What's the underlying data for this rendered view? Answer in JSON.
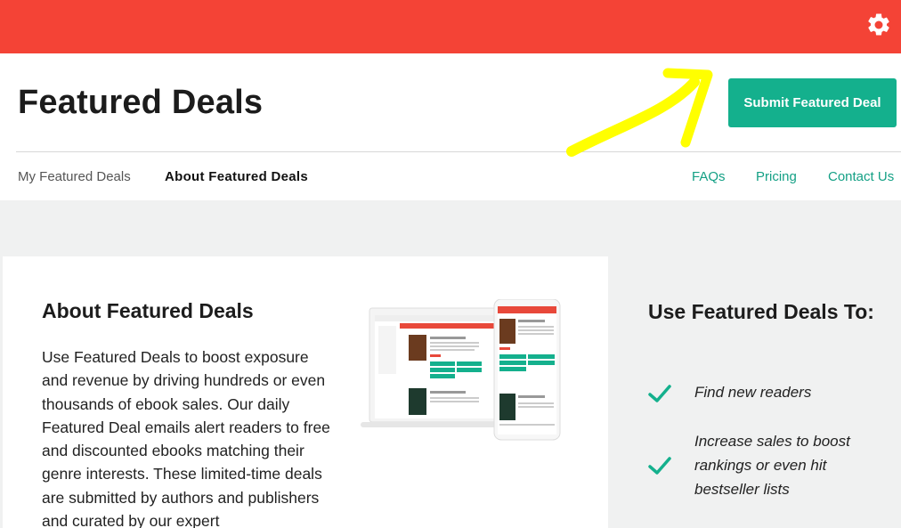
{
  "header": {
    "title": "Featured Deals",
    "submit_label": "Submit Featured Deal",
    "settings_icon": "gear-icon"
  },
  "tabs": {
    "my_deals": "My Featured Deals",
    "about": "About Featured Deals"
  },
  "nav": {
    "faqs": "FAQs",
    "pricing": "Pricing",
    "contact": "Contact Us"
  },
  "about": {
    "heading": "About Featured Deals",
    "body": "Use Featured Deals to boost exposure and revenue by driving hundreds or even thousands of ebook sales. Our daily Featured Deal emails alert readers to free and discounted ebooks matching their genre interests. These limited-time deals are submitted by authors and publishers and curated by our expert"
  },
  "sidebar": {
    "heading": "Use Featured Deals To:",
    "benefits": [
      "Find new readers",
      "Increase sales to boost rankings or even hit bestseller lists"
    ]
  },
  "colors": {
    "topbar": "#f44336",
    "accent": "#14b08d",
    "annotation_arrow": "#ffff00"
  }
}
